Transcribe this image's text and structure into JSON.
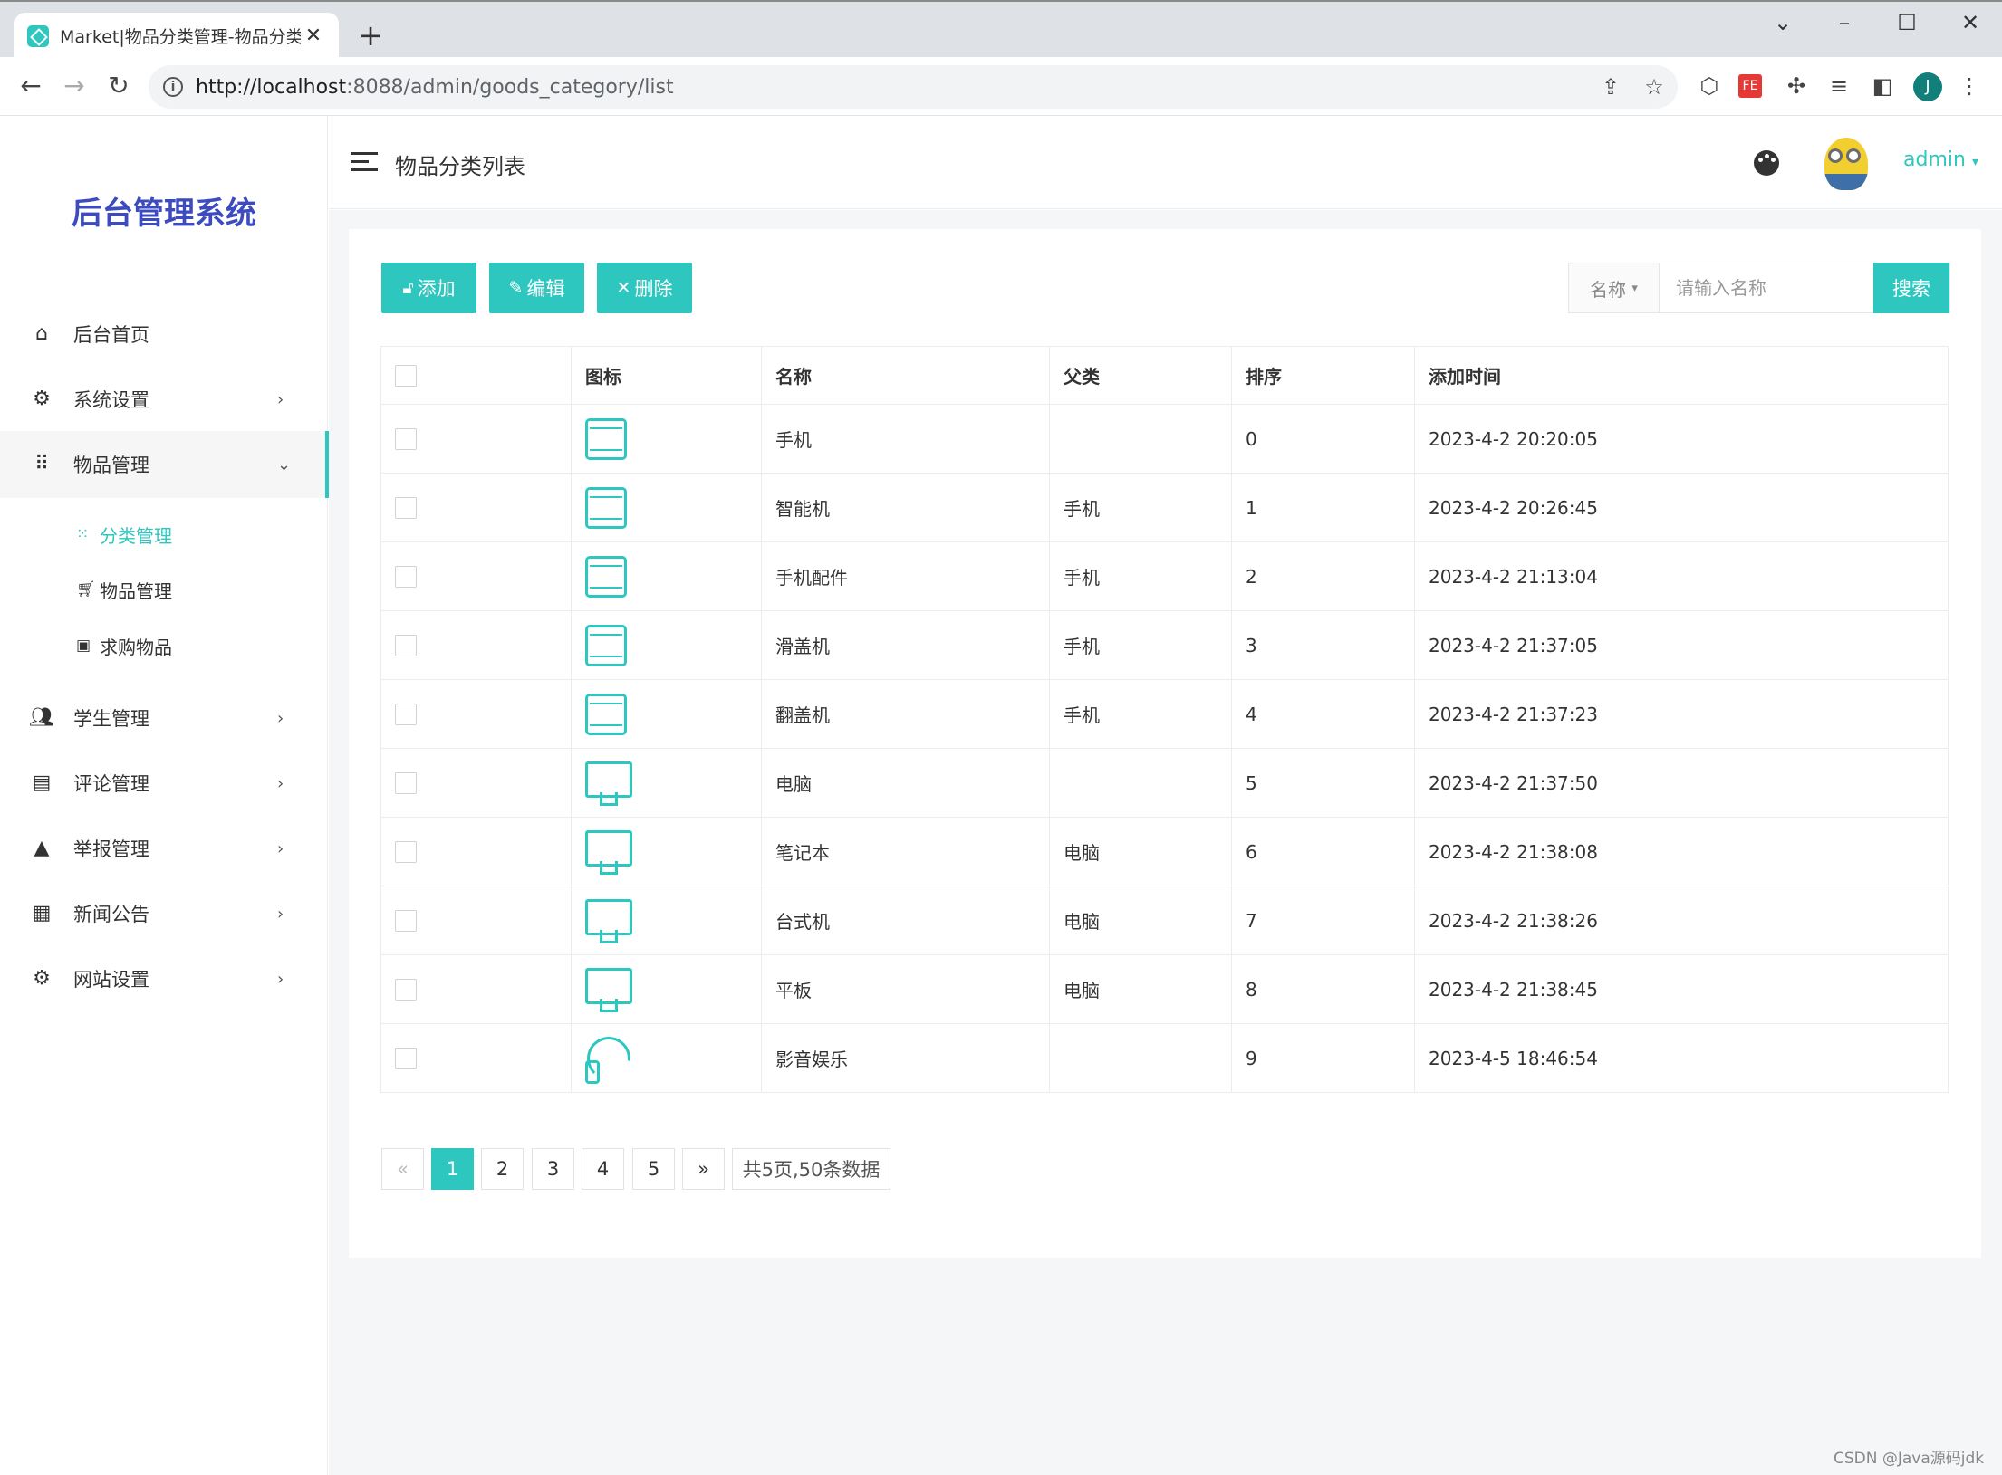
{
  "browser": {
    "tab_title": "Market|物品分类管理-物品分类",
    "url_host": "http://localhost",
    "url_rest": ":8088/admin/goods_category/list",
    "profile_initial": "J",
    "extension_badge": "FE"
  },
  "sidebar": {
    "brand": "后台管理系统",
    "items": [
      {
        "label": "后台首页",
        "icon": "home-icon"
      },
      {
        "label": "系统设置",
        "icon": "gear-icon"
      },
      {
        "label": "物品管理",
        "icon": "grid-dots-icon"
      },
      {
        "label": "学生管理",
        "icon": "users-icon"
      },
      {
        "label": "评论管理",
        "icon": "comment-icon"
      },
      {
        "label": "举报管理",
        "icon": "warning-icon"
      },
      {
        "label": "新闻公告",
        "icon": "news-icon"
      },
      {
        "label": "网站设置",
        "icon": "gear-icon"
      }
    ],
    "sub_items": [
      {
        "label": "分类管理",
        "icon": "apps-icon"
      },
      {
        "label": "物品管理",
        "icon": "cart-icon"
      },
      {
        "label": "求购物品",
        "icon": "ticket-icon"
      }
    ]
  },
  "header": {
    "title": "物品分类列表",
    "user": "admin"
  },
  "actions": {
    "add": "添加",
    "edit": "编辑",
    "delete": "删除"
  },
  "search": {
    "field": "名称",
    "placeholder": "请输入名称",
    "button": "搜索"
  },
  "table": {
    "columns": [
      "图标",
      "名称",
      "父类",
      "排序",
      "添加时间"
    ],
    "rows": [
      {
        "icon": "phone",
        "name": "手机",
        "parent": "",
        "sort": "0",
        "time": "2023-4-2 20:20:05"
      },
      {
        "icon": "phone",
        "name": "智能机",
        "parent": "手机",
        "sort": "1",
        "time": "2023-4-2 20:26:45"
      },
      {
        "icon": "phone",
        "name": "手机配件",
        "parent": "手机",
        "sort": "2",
        "time": "2023-4-2 21:13:04"
      },
      {
        "icon": "phone",
        "name": "滑盖机",
        "parent": "手机",
        "sort": "3",
        "time": "2023-4-2 21:37:05"
      },
      {
        "icon": "phone",
        "name": "翻盖机",
        "parent": "手机",
        "sort": "4",
        "time": "2023-4-2 21:37:23"
      },
      {
        "icon": "monitor",
        "name": "电脑",
        "parent": "",
        "sort": "5",
        "time": "2023-4-2 21:37:50"
      },
      {
        "icon": "monitor",
        "name": "笔记本",
        "parent": "电脑",
        "sort": "6",
        "time": "2023-4-2 21:38:08"
      },
      {
        "icon": "monitor",
        "name": "台式机",
        "parent": "电脑",
        "sort": "7",
        "time": "2023-4-2 21:38:26"
      },
      {
        "icon": "monitor",
        "name": "平板",
        "parent": "电脑",
        "sort": "8",
        "time": "2023-4-2 21:38:45"
      },
      {
        "icon": "headphone",
        "name": "影音娱乐",
        "parent": "",
        "sort": "9",
        "time": "2023-4-5 18:46:54"
      }
    ]
  },
  "pagination": {
    "prev": "«",
    "pages": [
      "1",
      "2",
      "3",
      "4",
      "5"
    ],
    "current": "1",
    "next": "»",
    "summary": "共5页,50条数据"
  },
  "watermark": "CSDN @Java源码jdk",
  "colors": {
    "accent": "#2ec7bf",
    "brand": "#3c4bbf",
    "time_text": "#1fae7a"
  }
}
